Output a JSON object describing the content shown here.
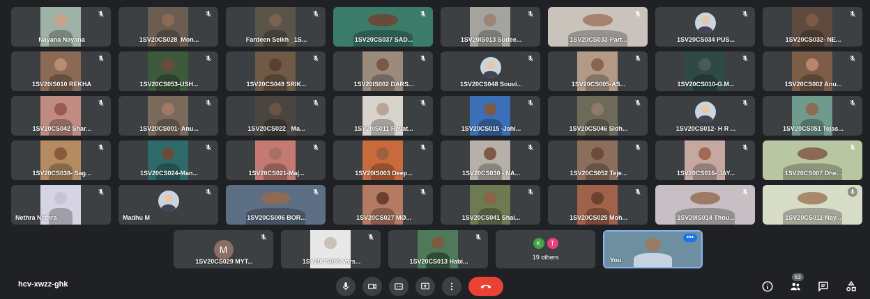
{
  "colors": {
    "background": "#202124",
    "tile": "#3c4043",
    "hangup": "#ea4335",
    "accent": "#8ab4f8"
  },
  "participants": [
    {
      "name": "Nayana Nayana",
      "mic": "muted",
      "video": "#9fb2a7",
      "skin": "#c7a38b"
    },
    {
      "name": "1SV20CS028_Mon...",
      "mic": "muted",
      "video": "#6b5d52",
      "skin": "#8a6a52"
    },
    {
      "name": "Fardeen Seikh _1S...",
      "mic": "muted",
      "video": "#5a5449",
      "skin": "#7b6150"
    },
    {
      "name": "1SV20CS037 SAD...",
      "mic": "muted",
      "video": "#3b7b6a",
      "skin": "#6a4a3a",
      "full": true
    },
    {
      "name": "1SV20IS013 Sudee...",
      "mic": "muted",
      "video": "#a5a39e",
      "skin": "#9d8575"
    },
    {
      "name": "1SV20CS033-Part...",
      "mic": "muted",
      "video": "#c9c3bc",
      "skin": "#a8826c",
      "full": true
    },
    {
      "name": "1SV20CS034 PUS...",
      "mic": "muted",
      "avatar": true
    },
    {
      "name": "1SV20CS032- NE...",
      "mic": "muted",
      "video": "#5f4a3e",
      "skin": "#7b5a48"
    },
    {
      "name": "1SV20IS010 REKHA",
      "mic": "muted",
      "video": "#8a6a55",
      "skin": "#b88d70"
    },
    {
      "name": "1SV20CS053-USH...",
      "mic": "muted",
      "video": "#3e5a3c",
      "skin": "#6b4c3a"
    },
    {
      "name": "1SV20CS049 SRIK...",
      "mic": "muted",
      "video": "#6f5a46",
      "skin": "#5a4030"
    },
    {
      "name": "1SV20IS002 DARS...",
      "mic": "muted",
      "video": "#9a8b7c",
      "skin": "#7a5a45"
    },
    {
      "name": "1SV20CS048 Souvi...",
      "mic": "muted",
      "avatar": true
    },
    {
      "name": "1SV20CS005-AS...",
      "mic": "muted",
      "video": "#b29a86",
      "skin": "#8a6450"
    },
    {
      "name": "1SV20CS010-G.M...",
      "mic": "muted",
      "video": "#2f4a45",
      "skin": "#4a5a55"
    },
    {
      "name": "1SV20CS002 Anu...",
      "mic": "muted",
      "video": "#7d5d48",
      "skin": "#b8876a"
    },
    {
      "name": "1SV20CS042 Shar...",
      "mic": "muted",
      "video": "#c08b80",
      "skin": "#9b5a50"
    },
    {
      "name": "1SV20CS001- Anu...",
      "mic": "muted",
      "video": "#7a6a5c",
      "skin": "#9e7a62"
    },
    {
      "name": "1SV20CS022_ Ma...",
      "mic": "muted",
      "video": "#4a463f",
      "skin": "#6a5344"
    },
    {
      "name": "1SV20IS011 Revat...",
      "mic": "muted",
      "video": "#d8d4cc",
      "skin": "#b9a596"
    },
    {
      "name": "1SV20CS015 -Jahi...",
      "mic": "muted",
      "video": "#3b6fb8",
      "skin": "#7a5a45"
    },
    {
      "name": "1SV20CS046 Sidh...",
      "mic": "muted",
      "video": "#6e6a5a",
      "skin": "#8d7a68"
    },
    {
      "name": "1SV20CS012- H R ...",
      "mic": "muted",
      "avatar": true
    },
    {
      "name": "1SV20CS051 Tejas...",
      "mic": "muted",
      "video": "#6f9a8c",
      "skin": "#8f6a55"
    },
    {
      "name": "1SV20CS038- Sag...",
      "mic": "muted",
      "video": "#b58b62",
      "skin": "#8a5a3a"
    },
    {
      "name": "1SV20CS024-Man...",
      "mic": "muted",
      "video": "#2f6a6a",
      "skin": "#6a4a38"
    },
    {
      "name": "1SV20CS021-Maj...",
      "mic": "muted",
      "video": "#c47a72",
      "skin": "#a8705e"
    },
    {
      "name": "1SV20IS003 Deep...",
      "mic": "muted",
      "video": "#c86a3c",
      "skin": "#a06040"
    },
    {
      "name": "1SV20CS030 - NA...",
      "mic": "muted",
      "video": "#b7b0a8",
      "skin": "#7e5a46"
    },
    {
      "name": "1SV20CS052 Teje...",
      "mic": "muted",
      "video": "#8b6f5c",
      "skin": "#6e4a38"
    },
    {
      "name": "1SV20CS016- JAY...",
      "mic": "muted",
      "video": "#c6a8a0",
      "skin": "#a06a55"
    },
    {
      "name": "1SV20CS007 Dhe...",
      "mic": "muted",
      "video": "#b8c7a2",
      "skin": "#8a6a52",
      "full": true
    },
    {
      "name": "Nethra Nethra",
      "mic": "muted",
      "video": "#d6d3e2",
      "skin": "#c8c4d8",
      "left": true
    },
    {
      "name": "Madhu M",
      "mic": "muted",
      "avatar": true,
      "left": true
    },
    {
      "name": "1SV20CS006 BOR...",
      "mic": "muted",
      "video": "#5d6f84",
      "skin": "#8e6a55",
      "full": true
    },
    {
      "name": "1SV20CS027 MØ...",
      "mic": "muted",
      "video": "#b47a62",
      "skin": "#6a4030"
    },
    {
      "name": "1SV20CS041 Shai...",
      "mic": "muted",
      "video": "#6d7a52",
      "skin": "#8a6445"
    },
    {
      "name": "1SV20CS025 Moh...",
      "mic": "muted",
      "video": "#a0624a",
      "skin": "#6e4030"
    },
    {
      "name": "1SV20IS014 Thou...",
      "mic": "muted",
      "video": "#c7bfc4",
      "skin": "#9d7a68",
      "full": true
    },
    {
      "name": "1SV20CS011-Nay...",
      "mic": "speaking",
      "video": "#d8ddc8",
      "skin": "#a88a6a",
      "full": true
    }
  ],
  "bottom_row": {
    "participant_1": {
      "name": "1SV20CS029 MYT...",
      "initial": "M",
      "initial_color": "#8d6e63"
    },
    "participant_2": {
      "name": "1SV20CS055 Vars...",
      "video": "#e8e8e8",
      "skin": "#c8c2b8"
    },
    "participant_3": {
      "name": "1SV20CS013 Habi...",
      "video": "#4f7a5a",
      "skin": "#7e5a45"
    },
    "others": {
      "label": "19 others",
      "initial_1": "K",
      "initial_1_color": "#43a047",
      "initial_2": "T",
      "initial_2_color": "#ec407a"
    },
    "self": {
      "name": "You",
      "more_label": "•••"
    }
  },
  "toolbar": {
    "meeting_code": "hcv-xwzz-ghk",
    "participant_count": "63",
    "icons": [
      "mic-icon",
      "camera-icon",
      "captions-icon",
      "present-screen-icon",
      "more-options-icon",
      "hangup-icon"
    ],
    "right_icons": [
      "info-icon",
      "people-icon",
      "chat-icon",
      "activities-icon"
    ]
  }
}
